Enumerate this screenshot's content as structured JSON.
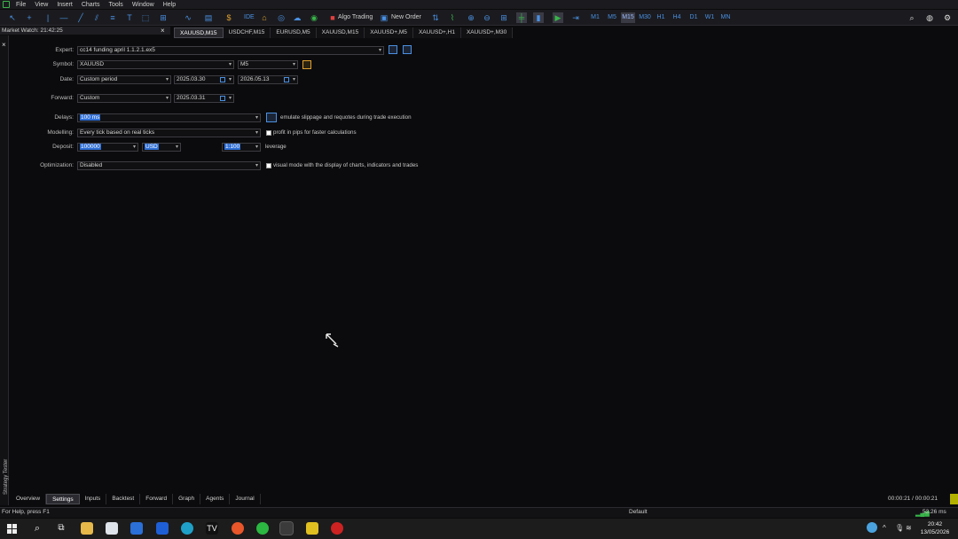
{
  "menu": [
    "File",
    "View",
    "Insert",
    "Charts",
    "Tools",
    "Window",
    "Help"
  ],
  "toolbar": {
    "ide_label": "IDE",
    "algo_trading_label": "Algo Trading",
    "new_order_label": "New Order",
    "timeframes": [
      "M1",
      "M5",
      "M15",
      "M30",
      "H1",
      "H4",
      "D1",
      "W1",
      "MN"
    ],
    "active_timeframe": "M15"
  },
  "market_watch": {
    "title": "Market Watch: 21:42:25"
  },
  "chart_tabs": [
    "XAUUSD,M15",
    "USDCHF,M15",
    "EURUSD,M5",
    "XAUUSD,M15",
    "XAUUSD+,M5",
    "XAUUSD+,H1",
    "XAUUSD+,M30"
  ],
  "active_chart_tab": 0,
  "strategy_tester": {
    "side_label": "Strategy Tester",
    "expert": {
      "label": "Expert:",
      "value": "cc14 funding april 1.1.2.1.ex5"
    },
    "symbol": {
      "label": "Symbol:",
      "value": "XAUUSD",
      "timeframe": "M5"
    },
    "date": {
      "label": "Date:",
      "mode": "Custom period",
      "from": "2025.03.30",
      "to": "2026.05.13"
    },
    "forward": {
      "label": "Forward:",
      "mode": "Custom",
      "date": "2025.03.31"
    },
    "delays": {
      "label": "Delays:",
      "value": "100 ms",
      "hint": "emulate slippage and requotes during trade execution"
    },
    "modelling": {
      "label": "Modelling:",
      "value": "Every tick based on real ticks",
      "hint": "profit in pips for faster calculations"
    },
    "deposit": {
      "label": "Deposit:",
      "amount": "100000",
      "currency": "USD",
      "leverage": "1:100",
      "leverage_label": "leverage"
    },
    "optimization": {
      "label": "Optimization:",
      "value": "Disabled",
      "hint": "visual mode with the display of charts, indicators and trades"
    }
  },
  "bottom_tabs": [
    "Overview",
    "Settings",
    "Inputs",
    "Backtest",
    "Forward",
    "Graph",
    "Agents",
    "Journal"
  ],
  "active_bottom_tab": 1,
  "timer": "00:00:21 / 00:00:21",
  "status": {
    "help": "For Help, press F1",
    "profile": "Default",
    "connection": "53.26 ms"
  },
  "clock": {
    "time": "20:42",
    "date": "13/05/2026"
  },
  "colors": {
    "accent": "#4a90e2",
    "selection": "#2f6fd6",
    "background": "#0b0b0d"
  }
}
